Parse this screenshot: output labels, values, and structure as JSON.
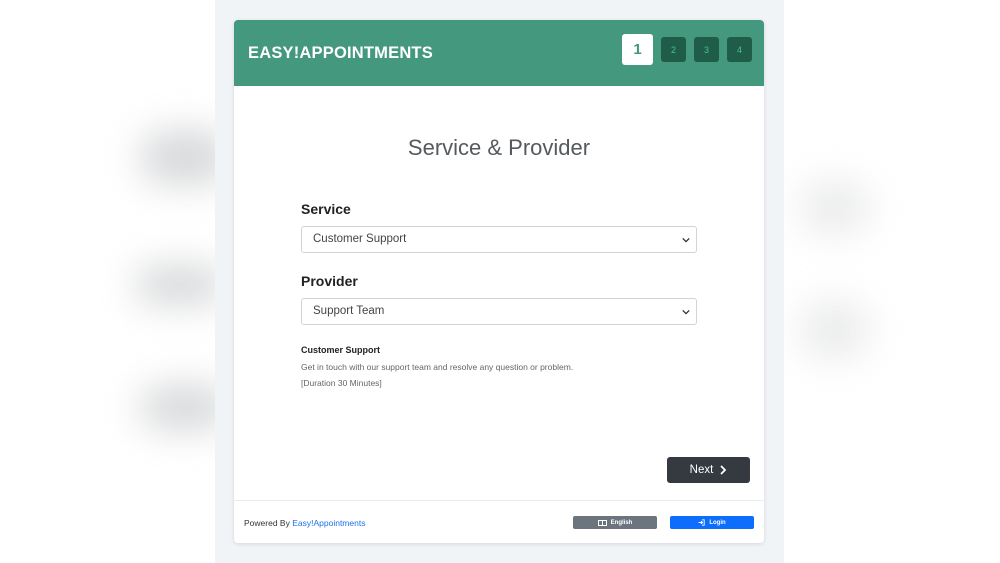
{
  "header": {
    "brand": "EASY!APPOINTMENTS",
    "steps": [
      "1",
      "2",
      "3",
      "4"
    ],
    "active_step": 1
  },
  "main": {
    "title": "Service & Provider",
    "service_label": "Service",
    "service_value": "Customer Support",
    "provider_label": "Provider",
    "provider_value": "Support Team",
    "info": {
      "name": "Customer Support",
      "description": "Get in touch with our support team and resolve any question or problem.",
      "duration": "[Duration 30 Minutes]"
    },
    "next_label": "Next"
  },
  "footer": {
    "powered_prefix": "Powered By",
    "powered_link": "Easy!Appointments",
    "language_label": "English",
    "login_label": "Login"
  },
  "colors": {
    "header": "#44987e",
    "step_inactive": "#1f5d49",
    "next_button": "#343a40",
    "language_button": "#6c757d",
    "login_button": "#0d6efd"
  },
  "icons": {
    "next": "chevron-right-icon",
    "language": "language-icon",
    "login": "sign-in-icon",
    "select": "chevron-down-icon"
  }
}
